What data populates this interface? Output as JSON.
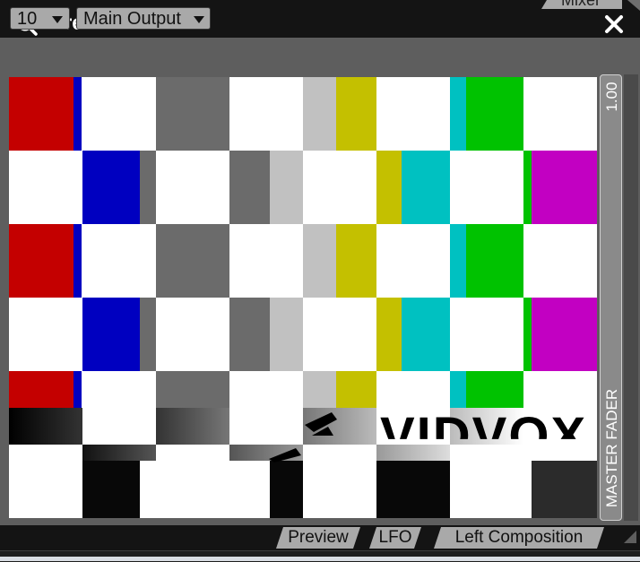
{
  "window": {
    "title": "Preview",
    "top_tab": "Mixer"
  },
  "controls": {
    "layer_select": "10",
    "output_select": "Main Output"
  },
  "fader": {
    "value": "1.00",
    "label": "MASTER FADER"
  },
  "tabs": [
    {
      "label": "Preview"
    },
    {
      "label": "LFO"
    },
    {
      "label": "Left Composition"
    }
  ],
  "preview_content": {
    "description_text": "VIDVOX"
  },
  "colors": {
    "red": "#c40000",
    "blue": "#0000c0",
    "gray": "#6b6b6b",
    "light_gray": "#c1c1c1",
    "yellow": "#c4c000",
    "cyan": "#00c1c1",
    "green": "#00c200",
    "magenta": "#c200c2",
    "black": "#080808",
    "dark_gray": "#2b2b2b"
  }
}
